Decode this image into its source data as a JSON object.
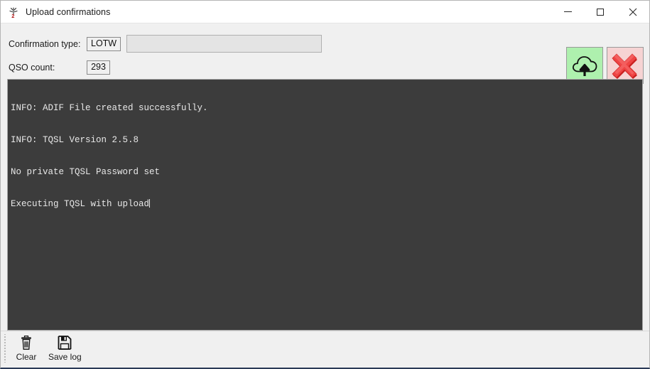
{
  "window": {
    "title": "Upload confirmations",
    "icon": "antenna-icon",
    "controls": {
      "minimize": "minimize-icon",
      "maximize": "maximize-icon",
      "close": "close-icon"
    }
  },
  "form": {
    "confirmation_type_label": "Confirmation type:",
    "confirmation_type_value": "LOTW",
    "confirmation_type_input_value": "",
    "confirmation_type_input_placeholder": "",
    "qso_count_label": "QSO count:",
    "qso_count_value": "293"
  },
  "actions": {
    "upload": {
      "name": "upload-button",
      "icon": "cloud-upload-icon",
      "tooltip": "Upload"
    },
    "cancel": {
      "name": "cancel-button",
      "icon": "red-x-icon",
      "tooltip": "Cancel"
    }
  },
  "log": {
    "lines": [
      "INFO: ADIF File created successfully.",
      "INFO: TQSL Version 2.5.8",
      "No private TQSL Password set",
      "Executing TQSL with upload"
    ],
    "background_color": "#3c3c3c",
    "text_color": "#e8e8e8",
    "caret_visible": true
  },
  "toolbar": {
    "clear_label": "Clear",
    "clear_icon": "trash-icon",
    "save_label": "Save log",
    "save_icon": "floppy-disk-icon"
  },
  "colors": {
    "upload_green": "#aef0ae",
    "cancel_pink": "#f6d3d3",
    "red_x": "#e23b3b",
    "window_background": "#f0f0f0"
  }
}
